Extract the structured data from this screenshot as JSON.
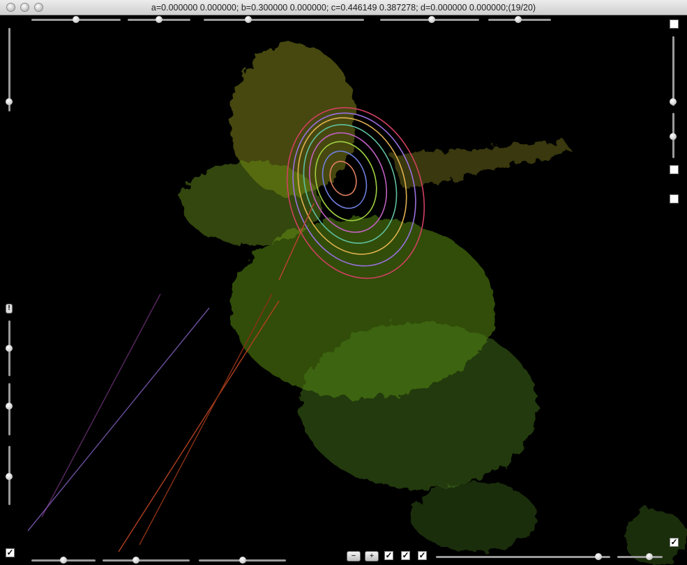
{
  "window": {
    "title": "a=0.000000 0.000000; b=0.300000 0.000000; c=0.446149 0.387278; d=0.000000 0.000000;(19/20)"
  },
  "controls": {
    "minus_button": "−",
    "plus_button": "+",
    "check_mark": "✓",
    "alert_mark": "!"
  },
  "sliders": {
    "top": [
      0.45,
      0.55,
      0.27,
      0.55,
      0.45
    ],
    "bottom": [
      0.5,
      0.35,
      0.5,
      0.8,
      0.65
    ],
    "left": [
      0.9,
      0.5,
      0.5,
      0.5
    ],
    "right": [
      0.93,
      0.5
    ]
  },
  "colors": {
    "background": "#000000",
    "fractal_green": "#7fbf1f",
    "fractal_olive": "#8a8a1a",
    "accent_pink": "#d04060",
    "accent_violet": "#9a70e0"
  }
}
